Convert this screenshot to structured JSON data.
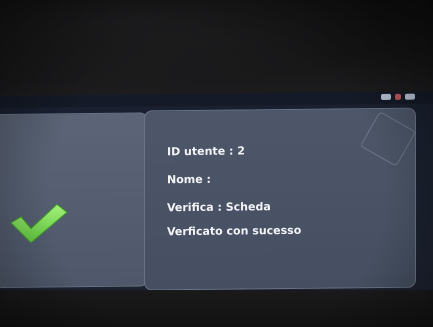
{
  "result": {
    "id_line": "ID utente : 2",
    "name_line": "Nome :",
    "verify_line": "Verifica : Scheda",
    "status_line": "Verficato con sucesso"
  },
  "icons": {
    "success": "checkmark-icon"
  },
  "colors": {
    "checkmark": "#7ed957",
    "panel": "#4d5769",
    "text": "#f2f4f7"
  }
}
